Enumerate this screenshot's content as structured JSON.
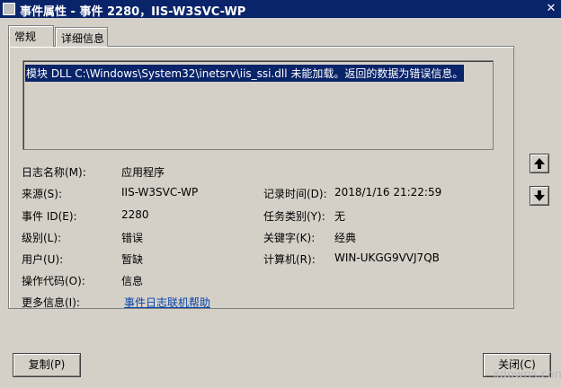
{
  "window": {
    "title": "事件属性 - 事件 2280，IIS-W3SVC-WP",
    "close_glyph": "✕"
  },
  "tabs": [
    {
      "label": "常规"
    },
    {
      "label": "详细信息"
    }
  ],
  "general": {
    "description": "模块 DLL C:\\Windows\\System32\\inetsrv\\iis_ssi.dll 未能加载。返回的数据为错误信息。",
    "log_name_label": "日志名称(M):",
    "log_name_value": "应用程序",
    "source_label": "来源(S):",
    "source_value": "IIS-W3SVC-WP",
    "logged_label": "记录时间(D):",
    "logged_value": "2018/1/16 21:22:59",
    "event_id_label": "事件 ID(E):",
    "event_id_value": "2280",
    "task_label": "任务类别(Y):",
    "task_value": "无",
    "level_label": "级别(L):",
    "level_value": "错误",
    "keywords_label": "关键字(K):",
    "keywords_value": "经典",
    "user_label": "用户(U):",
    "user_value": "暂缺",
    "computer_label": "计算机(R):",
    "computer_value": "WIN-UKGG9VVJ7QB",
    "opcode_label": "操作代码(O):",
    "opcode_value": "信息",
    "more_info_label": "更多信息(I):",
    "more_info_link": "事件日志联机帮助"
  },
  "side_buttons": {
    "up_icon": "arrow-up-icon",
    "down_icon": "arrow-down-icon"
  },
  "buttons": {
    "copy": "复制(P)",
    "close": "关闭(C)"
  },
  "watermark": "xdowns.com"
}
